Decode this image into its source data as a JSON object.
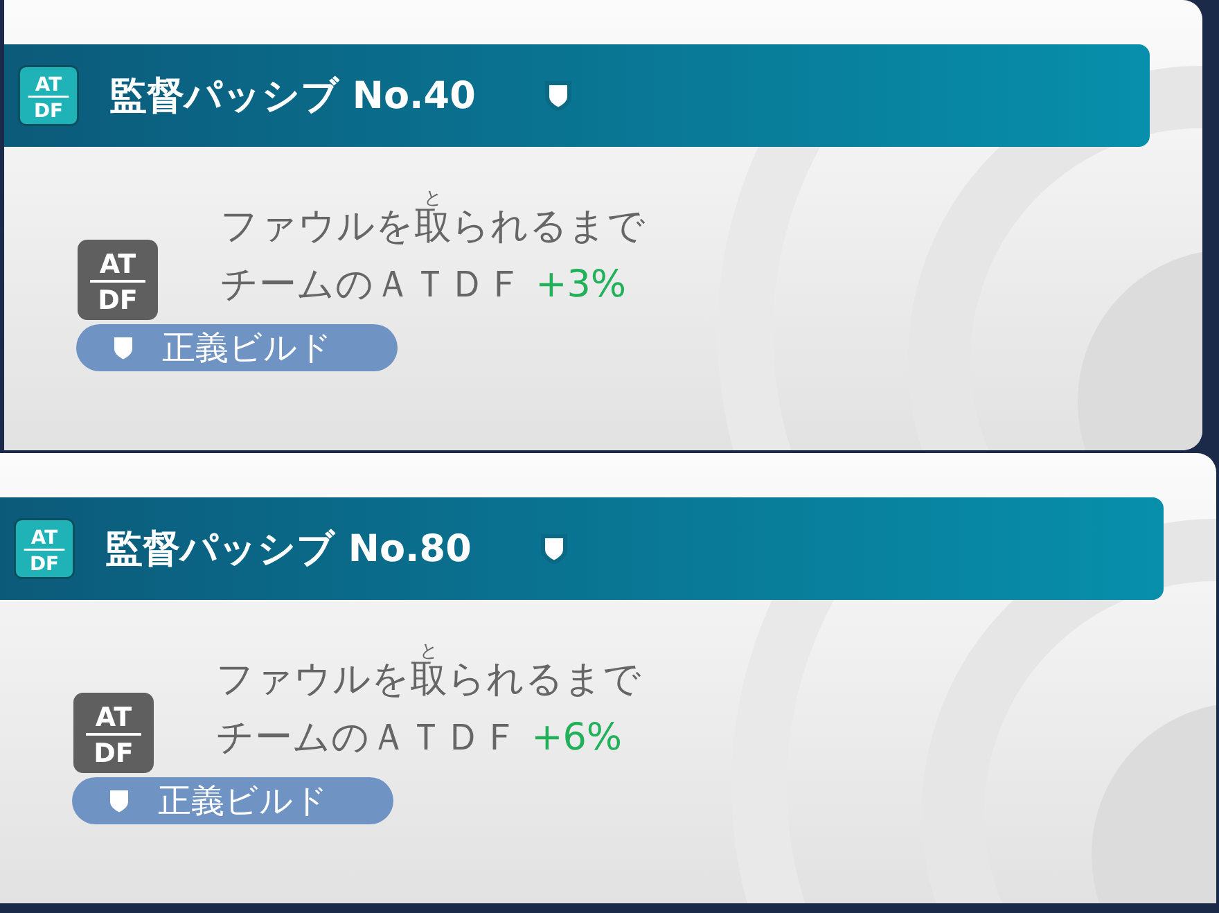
{
  "cards": [
    {
      "title": "監督パッシブ No.40",
      "header_icon_lines": [
        "AT",
        "DF"
      ],
      "body_icon_lines": [
        "AT",
        "DF"
      ],
      "line1": {
        "before": "ファウルを",
        "ruby_base": "取",
        "ruby": "と",
        "after": "られるまで"
      },
      "line2": "チームのＡＴＤＦ",
      "bonus": "+3%",
      "tag": "正義ビルド"
    },
    {
      "title": "監督パッシブ No.80",
      "header_icon_lines": [
        "AT",
        "DF"
      ],
      "body_icon_lines": [
        "AT",
        "DF"
      ],
      "line1": {
        "before": "ファウルを",
        "ruby_base": "取",
        "ruby": "と",
        "after": "られるまで"
      },
      "line2": "チームのＡＴＤＦ",
      "bonus": "+6%",
      "tag": "正義ビルド"
    }
  ]
}
